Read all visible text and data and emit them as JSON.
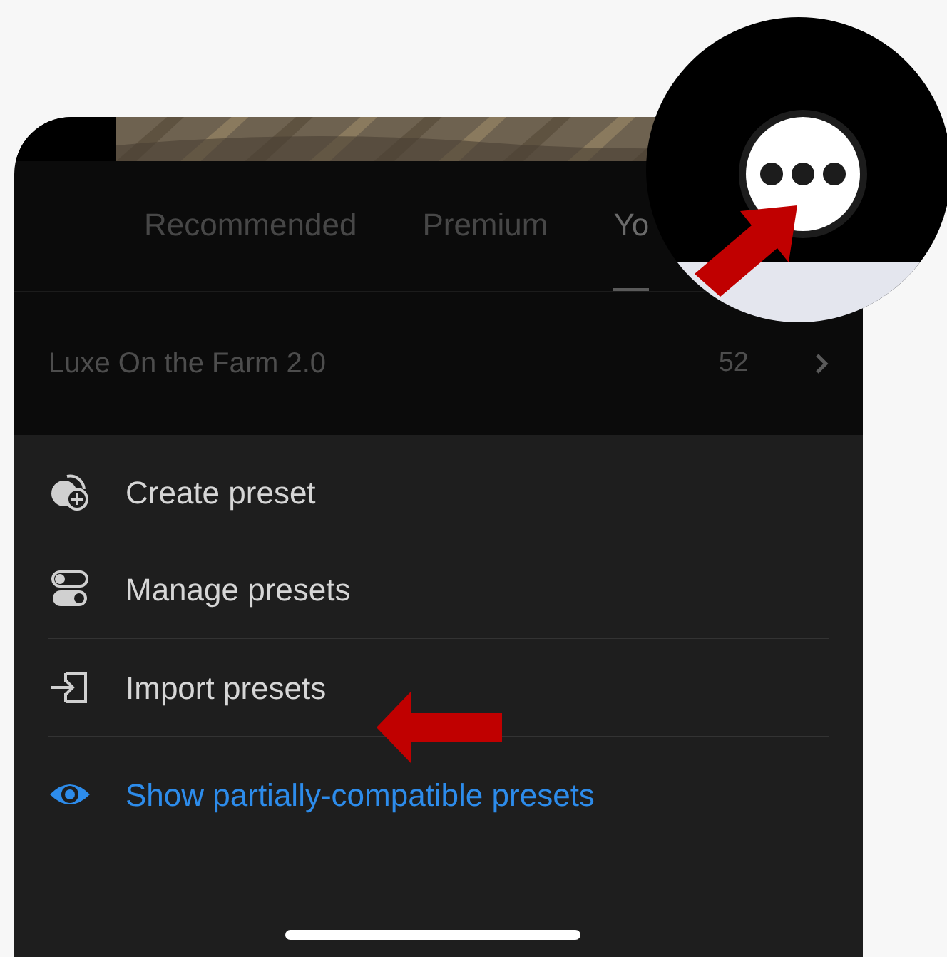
{
  "tabs": [
    {
      "label": "Recommended",
      "selected": false
    },
    {
      "label": "Premium",
      "selected": false
    },
    {
      "label": "Yo",
      "selected": true
    }
  ],
  "preset_groups": [
    {
      "name": "Luxe On the Farm 2.0",
      "count": "52"
    }
  ],
  "menu": {
    "sections": [
      {
        "items": [
          {
            "kind": "create",
            "label": "Create preset"
          },
          {
            "kind": "manage",
            "label": "Manage presets"
          }
        ]
      },
      {
        "items": [
          {
            "kind": "import",
            "label": "Import presets"
          }
        ]
      },
      {
        "items": [
          {
            "kind": "visibility",
            "label": "Show partially-compatible presets"
          }
        ]
      }
    ]
  }
}
